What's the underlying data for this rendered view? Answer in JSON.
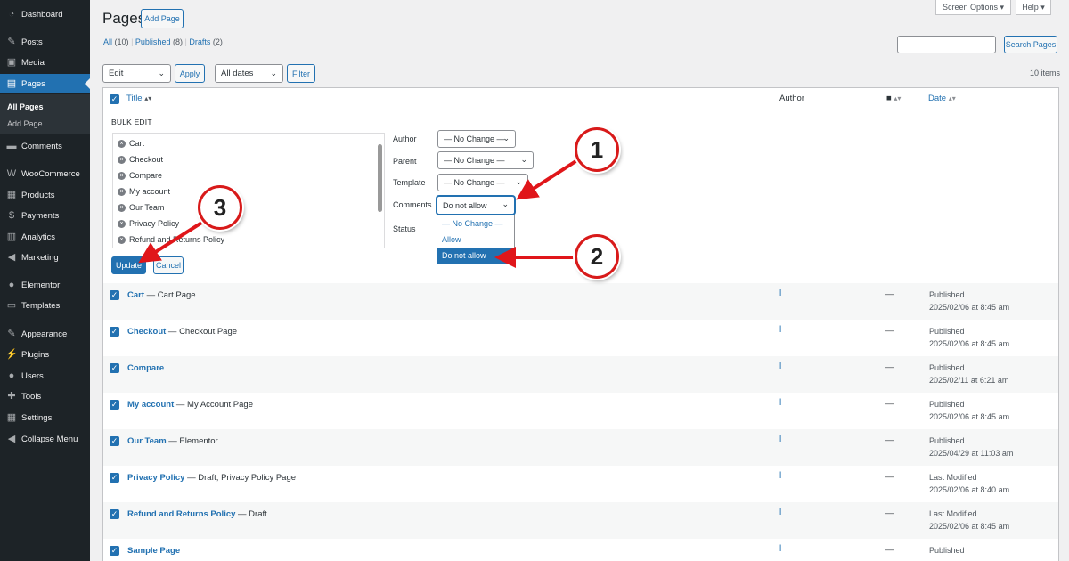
{
  "sidebar": {
    "items": [
      {
        "label": "Dashboard",
        "icon": "dashboard-icon",
        "glyph": "◔"
      },
      {
        "label": "Posts",
        "icon": "pin-icon",
        "glyph": "✎"
      },
      {
        "label": "Media",
        "icon": "media-icon",
        "glyph": "▣"
      },
      {
        "label": "Pages",
        "icon": "page-icon",
        "glyph": "▤"
      },
      {
        "label": "Comments",
        "icon": "comment-icon",
        "glyph": "▬"
      },
      {
        "label": "WooCommerce",
        "icon": "woo-icon",
        "glyph": "W"
      },
      {
        "label": "Products",
        "icon": "products-icon",
        "glyph": "▦"
      },
      {
        "label": "Payments",
        "icon": "payments-icon",
        "glyph": "$"
      },
      {
        "label": "Analytics",
        "icon": "analytics-icon",
        "glyph": "▥"
      },
      {
        "label": "Marketing",
        "icon": "megaphone-icon",
        "glyph": "◀"
      },
      {
        "label": "Elementor",
        "icon": "elementor-icon",
        "glyph": "●"
      },
      {
        "label": "Templates",
        "icon": "folder-icon",
        "glyph": "▭"
      },
      {
        "label": "Appearance",
        "icon": "brush-icon",
        "glyph": "✎"
      },
      {
        "label": "Plugins",
        "icon": "plugin-icon",
        "glyph": "⚡"
      },
      {
        "label": "Users",
        "icon": "users-icon",
        "glyph": "●"
      },
      {
        "label": "Tools",
        "icon": "wrench-icon",
        "glyph": "✚"
      },
      {
        "label": "Settings",
        "icon": "settings-icon",
        "glyph": "▦"
      },
      {
        "label": "Collapse Menu",
        "icon": "collapse-icon",
        "glyph": "◀"
      }
    ],
    "submenu": {
      "all_pages": "All Pages",
      "add_page": "Add Page"
    }
  },
  "header": {
    "title": "Pages",
    "add_page": "Add Page",
    "screen_options": "Screen Options ▾",
    "help": "Help ▾",
    "search_button": "Search Pages",
    "filters": {
      "all": "All",
      "all_count": "(10)",
      "published": "Published",
      "published_count": "(8)",
      "drafts": "Drafts",
      "drafts_count": "(2)",
      "sep": "|"
    }
  },
  "toolbar": {
    "bulk_action": "Edit",
    "apply": "Apply",
    "dates": "All dates",
    "filter": "Filter",
    "items_count": "10 items"
  },
  "table": {
    "headers": {
      "title": "Title",
      "author": "Author",
      "date": "Date"
    },
    "rows": [
      {
        "title": "Cart",
        "suffix": " — Cart Page",
        "author": "l",
        "comments": "—",
        "status": "Published",
        "date": "2025/02/06 at 8:45 am"
      },
      {
        "title": "Checkout",
        "suffix": " — Checkout Page",
        "author": "l",
        "comments": "—",
        "status": "Published",
        "date": "2025/02/06 at 8:45 am"
      },
      {
        "title": "Compare",
        "suffix": "",
        "author": "l",
        "comments": "—",
        "status": "Published",
        "date": "2025/02/11 at 6:21 am"
      },
      {
        "title": "My account",
        "suffix": " — My Account Page",
        "author": "l",
        "comments": "—",
        "status": "Published",
        "date": "2025/02/06 at 8:45 am"
      },
      {
        "title": "Our Team",
        "suffix": " — Elementor",
        "author": "l",
        "comments": "—",
        "status": "Published",
        "date": "2025/04/29 at 11:03 am"
      },
      {
        "title": "Privacy Policy",
        "suffix": " — Draft, Privacy Policy Page",
        "author": "l",
        "comments": "—",
        "status": "Last Modified",
        "date": "2025/02/06 at 8:40 am"
      },
      {
        "title": "Refund and Returns Policy",
        "suffix": " — Draft",
        "author": "l",
        "comments": "—",
        "status": "Last Modified",
        "date": "2025/02/06 at 8:45 am"
      },
      {
        "title": "Sample Page",
        "suffix": "",
        "author": "l",
        "comments": "—",
        "status": "Published",
        "date": ""
      }
    ]
  },
  "bulk_edit": {
    "heading": "BULK EDIT",
    "pages": [
      "Cart",
      "Checkout",
      "Compare",
      "My account",
      "Our Team",
      "Privacy Policy",
      "Refund and Returns Policy"
    ],
    "labels": {
      "author": "Author",
      "parent": "Parent",
      "template": "Template",
      "comments": "Comments",
      "status": "Status"
    },
    "values": {
      "author": "— No Change —",
      "parent": "— No Change —",
      "template": "— No Change —",
      "comments": "Do not allow"
    },
    "comments_options": [
      "— No Change —",
      "Allow",
      "Do not allow"
    ],
    "update": "Update",
    "cancel": "Cancel"
  },
  "annotations": {
    "one": "1",
    "two": "2",
    "three": "3",
    "color": "#e0161a"
  }
}
